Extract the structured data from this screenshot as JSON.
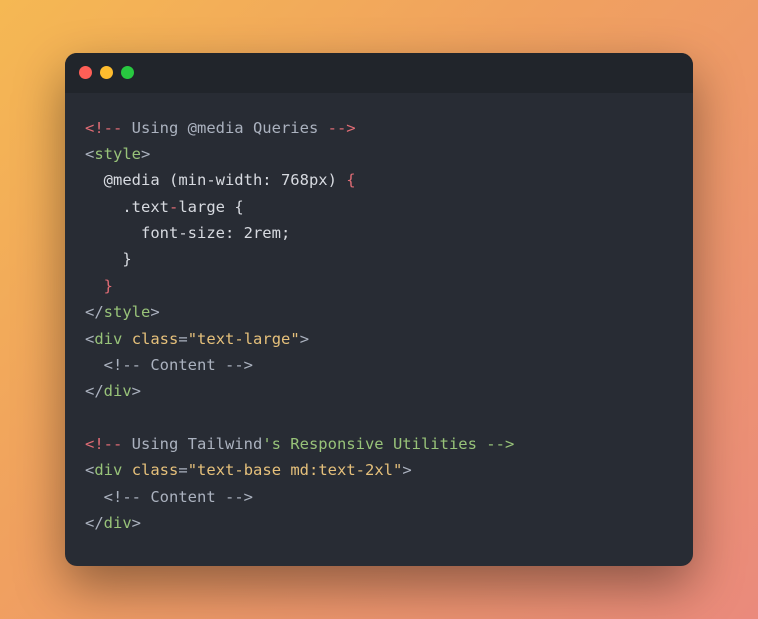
{
  "code": {
    "l1": {
      "a": "<!--",
      "b": " Using @media Queries ",
      "c": "-->"
    },
    "l2": {
      "a": "<",
      "b": "style",
      "c": ">"
    },
    "l3": "  @media (min-width: 768px) ",
    "l3b": "{",
    "l4": "    .text",
    "l4dash": "-",
    "l4b": "large {",
    "l5": "      font-size: 2rem;",
    "l6": "    }",
    "l7": "  }",
    "l8": {
      "a": "</",
      "b": "style",
      "c": ">"
    },
    "l9": {
      "a": "<",
      "b": "div",
      "c": " ",
      "d": "class",
      "e": "=",
      "f": "\"text-large\"",
      "g": ">"
    },
    "l10": {
      "a": "  <!--",
      "b": " Content ",
      "c": "-->"
    },
    "l11": {
      "a": "</",
      "b": "div",
      "c": ">"
    },
    "l12": "",
    "l13": {
      "a": "<!--",
      "b": " Using Tailwind",
      "c": "'s Responsive Utilities -->"
    },
    "l14": {
      "a": "<",
      "b": "div",
      "c": " ",
      "d": "class",
      "e": "=",
      "f": "\"text-base md:text-2xl\"",
      "g": ">"
    },
    "l15": {
      "a": "  <!--",
      "b": " Content ",
      "c": "-->"
    },
    "l16": {
      "a": "</",
      "b": "div",
      "c": ">"
    }
  }
}
